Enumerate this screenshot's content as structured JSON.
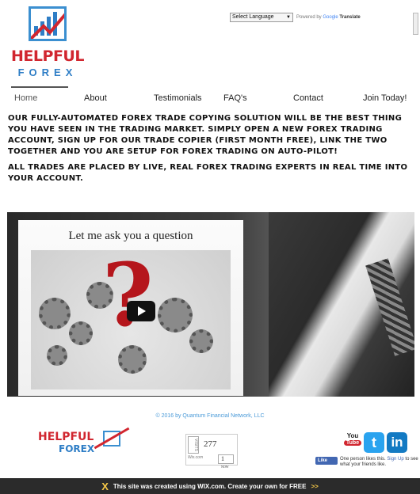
{
  "logo": {
    "line1": "HELPFUL",
    "line2": "FOREX",
    "brand_red": "#d1262f",
    "brand_blue": "#2f7ec6"
  },
  "translate": {
    "select_label": "Select Language",
    "powered_by": "Powered by",
    "google": "Google",
    "translate": "Translate"
  },
  "nav": {
    "items": [
      {
        "label": "Home",
        "active": true
      },
      {
        "label": "About"
      },
      {
        "label": "Testimonials"
      },
      {
        "label": "FAQ's"
      },
      {
        "label": "Contact"
      },
      {
        "label": "Join Today!"
      }
    ]
  },
  "intro": {
    "paragraph1": "Our fully-automated forex trade copying solution will be the best thing you have seen in the trading market.  Simply open a new forex trading account, sign up for our trade copier (first month FREE), link the two together and you are setup for forex trading on auto-pilot!",
    "paragraph2": "All trades are placed by live, real forex trading experts in real time into your account."
  },
  "video": {
    "slide_title": "Let me ask you a question",
    "play_icon": "play-icon"
  },
  "footer": {
    "copyright": "© 2016 by Quantum Financial Network, LLC",
    "logo_line1": "HELPFUL",
    "logo_line2": "FOREX",
    "counter": {
      "side1": "VISITS",
      "value1": "277",
      "side2": "Wix.com",
      "value2": "1",
      "value2_small": "NOW"
    },
    "social": {
      "youtube_top": "You",
      "youtube_bottom": "Tube",
      "twitter": "t",
      "linkedin": "in"
    },
    "facebook": {
      "button": "Like",
      "text_before": "One person likes this. ",
      "signup": "Sign Up",
      "text_after": " to see what your friends like."
    }
  },
  "wix_banner": {
    "text": "This site was created using WIX.com. Create your own for FREE",
    "arrows": ">>"
  }
}
